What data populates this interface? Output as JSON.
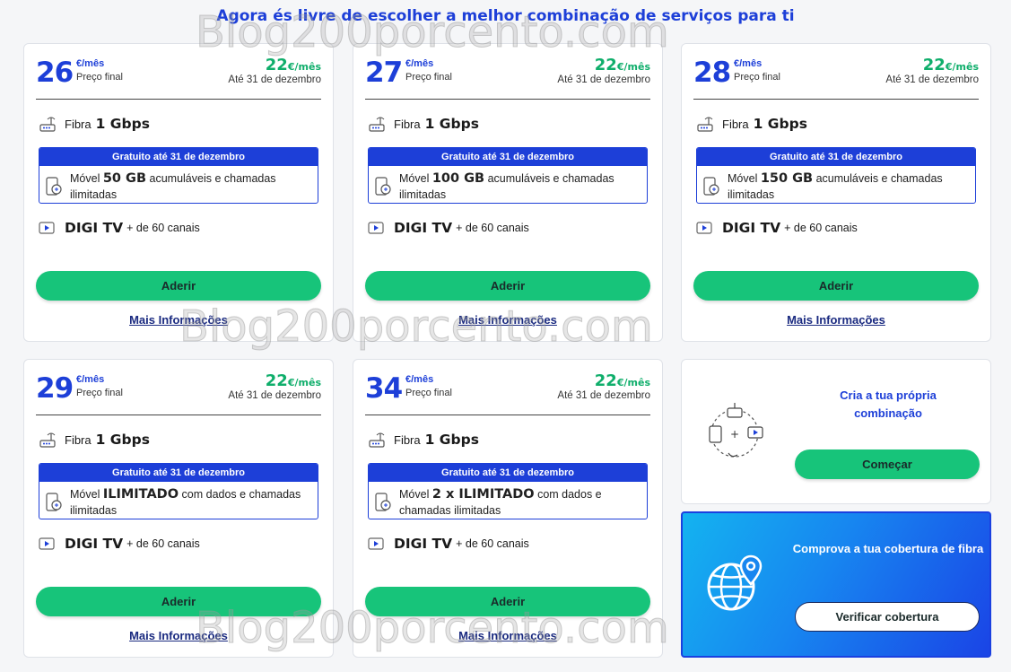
{
  "headline": "Agora és livre de escolher a melhor combinação de serviços para ti",
  "common": {
    "unit": "€/mês",
    "final_label": "Preço final",
    "promo_price": "22",
    "promo_unit": "€/mês",
    "until": "Até 31 de dezembro",
    "fibra_label": "Fibra",
    "fibra_speed": "1 Gbps",
    "free_bar": "Gratuito até 31 de dezembro",
    "movel_label": "Móvel",
    "tv_name": "DIGI TV",
    "tv_channels": "+ de 60 canais",
    "join_label": "Aderir",
    "more_label": "Mais Informações"
  },
  "plans": [
    {
      "price": "26",
      "mobile_highlight": "50 GB",
      "mobile_rest": "acumuláveis e chamadas ilimitadas"
    },
    {
      "price": "27",
      "mobile_highlight": "100 GB",
      "mobile_rest": "acumuláveis e chamadas ilimitadas"
    },
    {
      "price": "28",
      "mobile_highlight": "150 GB",
      "mobile_rest": "acumuláveis e chamadas ilimitadas"
    },
    {
      "price": "29",
      "mobile_highlight": "ILIMITADO",
      "mobile_rest": "com dados e chamadas ilimitadas"
    },
    {
      "price": "34",
      "mobile_highlight": "2 x ILIMITADO",
      "mobile_rest": "com dados e chamadas ilimitadas"
    }
  ],
  "combo": {
    "title": "Cria a tua própria combinação",
    "button": "Começar"
  },
  "coverage": {
    "title": "Comprova a tua cobertura de fibra",
    "button": "Verificar cobertura"
  },
  "watermark": "Blog200porcento.com",
  "colors": {
    "brand_blue": "#1d3fd8",
    "promo_green": "#0fae6b",
    "button_green": "#17c47a"
  }
}
